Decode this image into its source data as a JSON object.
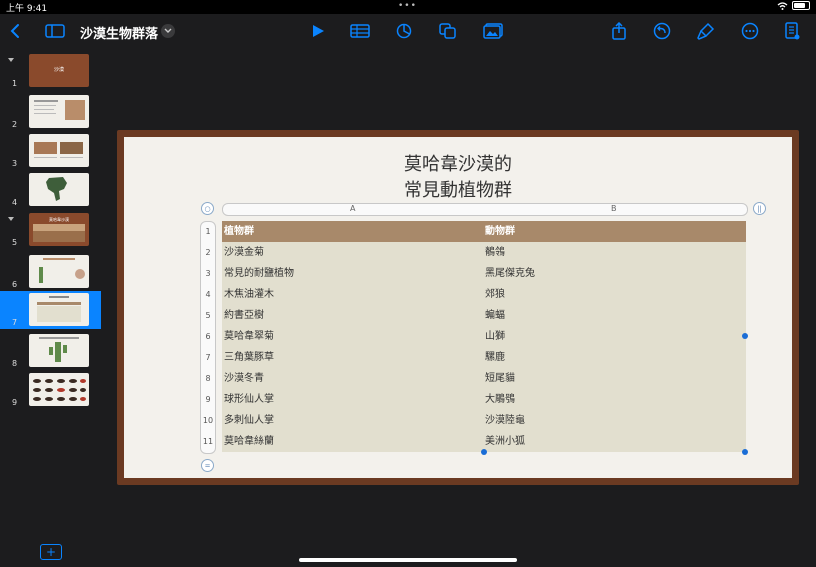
{
  "status": {
    "time": "上午 9:41",
    "dots": "•••"
  },
  "toolbar": {
    "doc_title": "沙漠生物群落",
    "left_icons": [
      "back-chevron-icon",
      "sidebar-toggle-icon"
    ],
    "center_icons": [
      "play-icon",
      "table-icon",
      "chart-icon",
      "shapes-icon",
      "media-icon"
    ],
    "right_icons": [
      "share-icon",
      "undo-icon",
      "format-brush-icon",
      "more-icon",
      "document-icon"
    ],
    "accent_color": "#0a84ff"
  },
  "sidebar": {
    "slides": [
      {
        "num": "1",
        "title": "沙漠",
        "style": "brown",
        "collapsible": true
      },
      {
        "num": "2",
        "style": "light"
      },
      {
        "num": "3",
        "style": "light"
      },
      {
        "num": "4",
        "style": "light"
      },
      {
        "num": "5",
        "title": "莫哈韋沙漠",
        "style": "brown",
        "collapsible": true
      },
      {
        "num": "6",
        "style": "light"
      },
      {
        "num": "7",
        "style": "light",
        "selected": true
      },
      {
        "num": "8",
        "style": "light"
      },
      {
        "num": "9",
        "style": "light"
      }
    ]
  },
  "slide": {
    "title_line1": "莫哈韋沙漠的",
    "title_line2": "常見動植物群",
    "column_letters": [
      "A",
      "B"
    ],
    "row_numbers": [
      "1",
      "2",
      "3",
      "4",
      "5",
      "6",
      "7",
      "8",
      "9",
      "10",
      "11"
    ],
    "table": {
      "headers": [
        "植物群",
        "動物群"
      ],
      "rows": [
        [
          "沙漠金菊",
          "鶺鴒"
        ],
        [
          "常見的耐鹽植物",
          "黑尾傑克兔"
        ],
        [
          "木焦油灌木",
          "郊狼"
        ],
        [
          "約書亞樹",
          "蝙蝠"
        ],
        [
          "莫哈韋翠菊",
          "山獅"
        ],
        [
          "三角葉豚草",
          "騾鹿"
        ],
        [
          "沙漠冬青",
          "短尾貓"
        ],
        [
          "球形仙人掌",
          "大鵰鴞"
        ],
        [
          "多刺仙人掌",
          "沙漠陸龜"
        ],
        [
          "莫哈韋絲蘭",
          "美洲小狐"
        ]
      ]
    },
    "header_color": "#a8896a",
    "body_color": "#e2dfcf",
    "frame_color": "#6b3a22"
  }
}
